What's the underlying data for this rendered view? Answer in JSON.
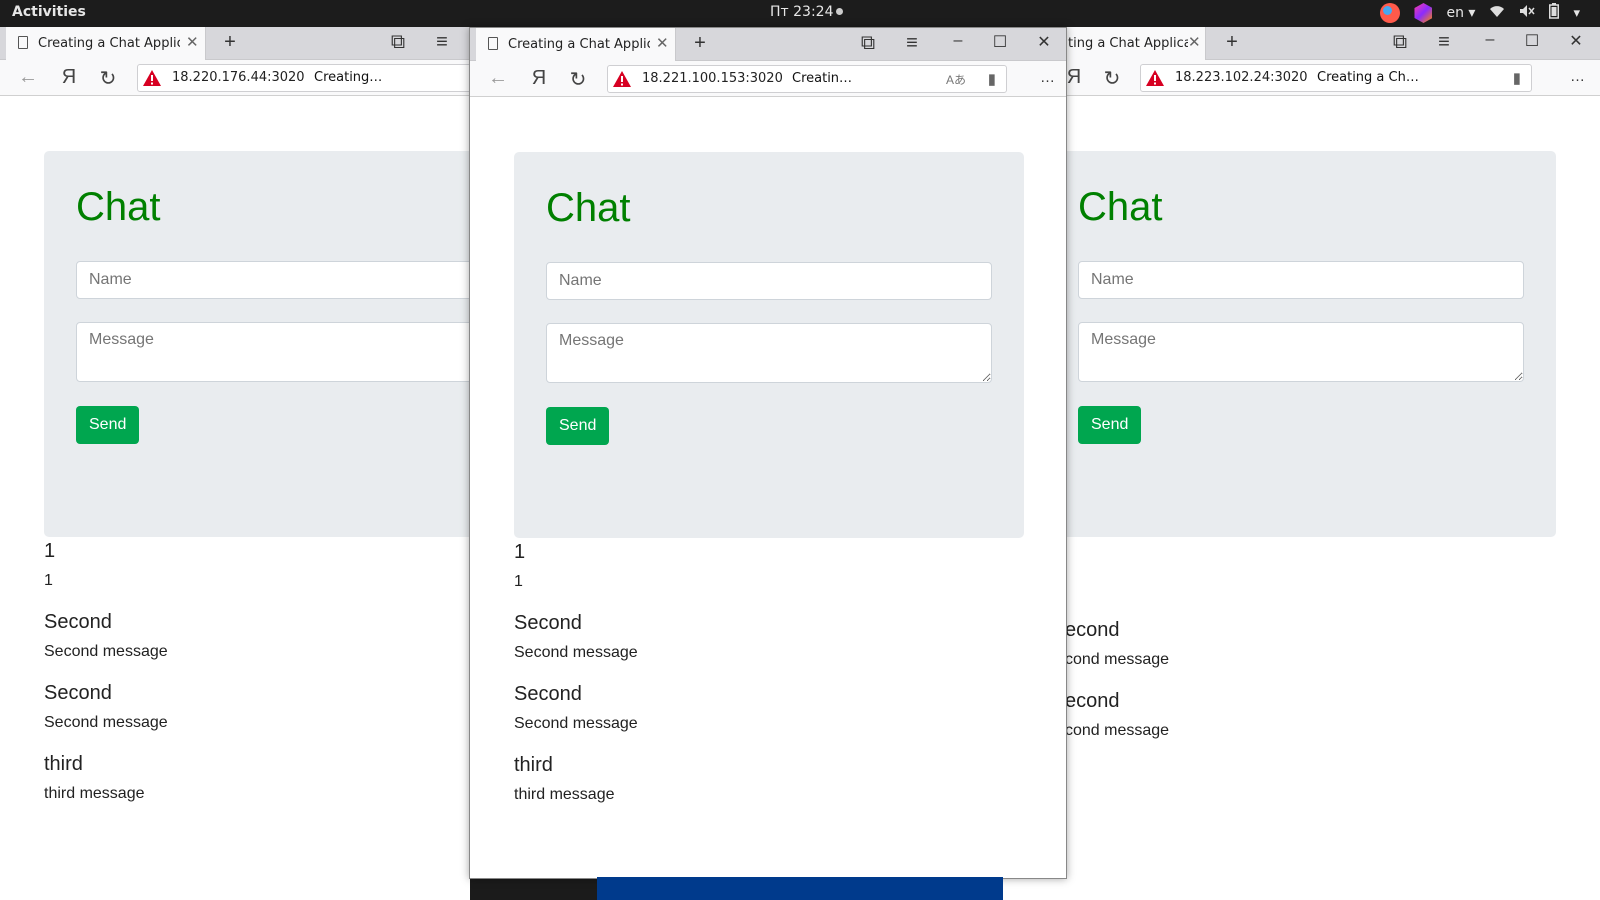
{
  "desktop": {
    "activities": "Activities",
    "clock": "Пт 23:24",
    "tray": {
      "lang": "en"
    }
  },
  "windows": [
    {
      "tab_title": "Creating a Chat Applicat",
      "url": "18.220.176.44:3020",
      "page_title": "Creating…"
    },
    {
      "tab_title": "Creating a Chat Applicat",
      "url": "18.221.100.153:3020",
      "page_title": "Creatin…"
    },
    {
      "tab_title": "ting a Chat Applicat",
      "url": "18.223.102.24:3020",
      "page_title": "Creating a Ch…"
    }
  ],
  "page": {
    "heading": "Chat",
    "name_placeholder": "Name",
    "message_placeholder": "Message",
    "send_label": "Send",
    "messages": [
      {
        "name": "1",
        "text": "1"
      },
      {
        "name": "Second",
        "text": "Second message"
      },
      {
        "name": "Second",
        "text": "Second message"
      },
      {
        "name": "third",
        "text": "third message"
      }
    ],
    "right_window_messages": [
      {
        "name": "",
        "text": ""
      },
      {
        "name": "econd",
        "text": "cond message"
      },
      {
        "name": "econd",
        "text": "cond message"
      },
      {
        "name": "",
        "text": ""
      }
    ]
  },
  "colors": {
    "chat_heading": "#008000",
    "send_button": "#00a64f",
    "jumbotron": "#e9ecef",
    "warning_icon": "#d70022"
  }
}
